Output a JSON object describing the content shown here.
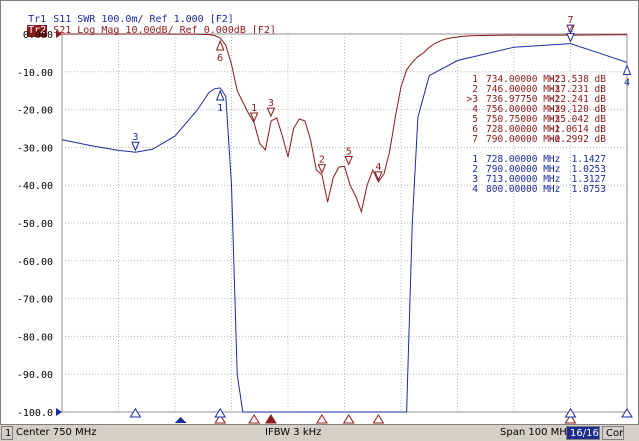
{
  "traces": {
    "tr1": {
      "tag": "Tr1",
      "text": "S11 SWR 100.0m/ Ref 1.000 [F2]",
      "color": "#1c2ba0"
    },
    "tr2": {
      "tag": "Tr2",
      "text": "S21 Log Mag 10.00dB/ Ref 0.000dB [F2]",
      "color": "#8b1a1a"
    }
  },
  "status": {
    "channel": "1",
    "center": "Center 750 MHz",
    "ifbw": "IFBW 3 kHz",
    "span": "Span 100 MHz",
    "count": "16/16",
    "cor": "Cor"
  },
  "marker_tables": {
    "s21": [
      {
        "id": "1",
        "freq": "734.00000 MHz",
        "value": "-23.538 dB"
      },
      {
        "id": "2",
        "freq": "746.00000 MHz",
        "value": "-37.231 dB"
      },
      {
        "id": ">3",
        "freq": "736.97750 MHz",
        "value": "-22.241 dB"
      },
      {
        "id": "4",
        "freq": "756.00000 MHz",
        "value": "-39.120 dB"
      },
      {
        "id": "5",
        "freq": "750.75000 MHz",
        "value": "-35.042 dB"
      },
      {
        "id": "6",
        "freq": "728.00000 MHz",
        "value": "-1.0614 dB"
      },
      {
        "id": "7",
        "freq": "790.00000 MHz",
        "value": "-0.2992 dB"
      }
    ],
    "s11": [
      {
        "id": "1",
        "freq": "728.00000 MHz",
        "value": "1.1427"
      },
      {
        "id": "2",
        "freq": "790.00000 MHz",
        "value": "1.0253"
      },
      {
        "id": "3",
        "freq": "713.00000 MHz",
        "value": "1.3127"
      },
      {
        "id": "4",
        "freq": "800.00000 MHz",
        "value": "1.0753"
      }
    ]
  },
  "chart_data": {
    "type": "line",
    "xlim": [
      700,
      800
    ],
    "ylim": [
      -100,
      0
    ],
    "y_tick_labels": [
      "0.000",
      "-10.00",
      "-20.00",
      "-30.00",
      "-40.00",
      "-50.00",
      "-60.00",
      "-70.00",
      "-80.00",
      "-90.00",
      "-100.0"
    ],
    "grid": true,
    "series": [
      {
        "name": "S21",
        "color": "#8b1a1a",
        "x": [
          700,
          715,
          724,
          726,
          727,
          728,
          729,
          730,
          731,
          732,
          733,
          734,
          735,
          736,
          737,
          738,
          739,
          740,
          741,
          742,
          743,
          744,
          745,
          746,
          747,
          748,
          749,
          750,
          751,
          752,
          753,
          754,
          755,
          756,
          757,
          758,
          759,
          760,
          761,
          762,
          763,
          764,
          765,
          766,
          767,
          768,
          769,
          770,
          771,
          772,
          774,
          777,
          780,
          785,
          790,
          795,
          800
        ],
        "values": [
          0,
          0,
          -0.05,
          -0.15,
          -0.4,
          -1.06,
          -3,
          -8,
          -15,
          -18,
          -21,
          -23.5,
          -29,
          -30.7,
          -23,
          -22.2,
          -27,
          -32.5,
          -25,
          -22.5,
          -23,
          -28,
          -36,
          -37.2,
          -44.5,
          -38,
          -35.2,
          -35,
          -40,
          -43,
          -47,
          -40,
          -36,
          -39.1,
          -37,
          -31,
          -22,
          -14,
          -9.5,
          -7.5,
          -6,
          -5,
          -3.5,
          -2.5,
          -1.8,
          -1.3,
          -1,
          -0.8,
          -0.6,
          -0.5,
          -0.4,
          -0.33,
          -0.3,
          -0.3,
          -0.3,
          -0.25,
          -0.2
        ]
      },
      {
        "name": "S11",
        "color": "#1c2ba0",
        "x": [
          700,
          705,
          710,
          713,
          716,
          720,
          724,
          726,
          727,
          728,
          729,
          730,
          731,
          732,
          733,
          735,
          737,
          740,
          745,
          750,
          755,
          758,
          760,
          761,
          762,
          763,
          765,
          770,
          780,
          790,
          796,
          800
        ],
        "swr": [
          1.28,
          1.295,
          1.308,
          1.3127,
          1.305,
          1.27,
          1.2,
          1.155,
          1.145,
          1.1427,
          1.165,
          1.4,
          1.9,
          2.8,
          3.5,
          3.8,
          4,
          4,
          4,
          4,
          4,
          3.8,
          3.5,
          2.5,
          1.5,
          1.22,
          1.11,
          1.07,
          1.035,
          1.0253,
          1.055,
          1.0753
        ]
      }
    ],
    "markers_s21": [
      {
        "id": "1",
        "x": 734,
        "y": -23.538
      },
      {
        "id": "2",
        "x": 746,
        "y": -37.231
      },
      {
        "id": "3",
        "x": 736.9775,
        "y": -22.241
      },
      {
        "id": "4",
        "x": 756,
        "y": -39.12
      },
      {
        "id": "5",
        "x": 750.75,
        "y": -35.042
      },
      {
        "id": "6",
        "x": 728,
        "y": -1.0614
      },
      {
        "id": "7",
        "x": 790,
        "y": -0.2992
      }
    ],
    "markers_s11": [
      {
        "id": "1",
        "x": 728,
        "y": 1.1427
      },
      {
        "id": "2",
        "x": 790,
        "y": 1.0253
      },
      {
        "id": "3",
        "x": 713,
        "y": 1.3127
      },
      {
        "id": "4",
        "x": 800,
        "y": 1.0753
      }
    ]
  }
}
